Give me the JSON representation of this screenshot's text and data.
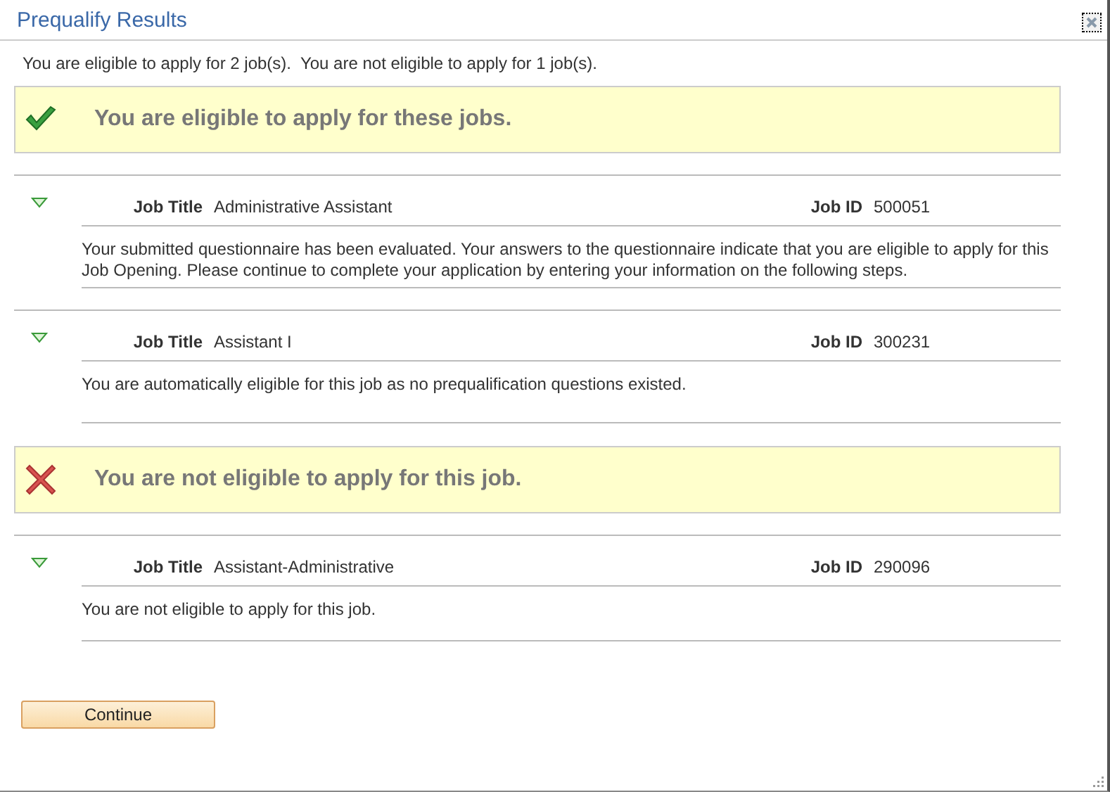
{
  "window": {
    "title": "Prequalify Results"
  },
  "summary": "You are eligible to apply for 2 job(s).  You are not eligible to apply for 1 job(s).",
  "sections": [
    {
      "kind": "eligible",
      "heading": "You are eligible to apply for these jobs.",
      "jobs": [
        {
          "expanded": true,
          "title_label": "Job Title",
          "title": "Administrative Assistant",
          "id_label": "Job ID",
          "id": "500051",
          "message": "Your submitted questionnaire has been evaluated. Your answers to the questionnaire indicate that you are eligible to apply for this Job Opening. Please continue to complete your application by entering your information on the following steps."
        },
        {
          "expanded": true,
          "title_label": "Job Title",
          "title": "Assistant I",
          "id_label": "Job ID",
          "id": "300231",
          "message": "You are automatically eligible for this job as no prequalification questions existed."
        }
      ]
    },
    {
      "kind": "not_eligible",
      "heading": "You are not eligible to apply for this job.",
      "jobs": [
        {
          "expanded": true,
          "title_label": "Job Title",
          "title": "Assistant-Administrative",
          "id_label": "Job ID",
          "id": "290096",
          "message": "You are not eligible to apply for this job."
        }
      ]
    }
  ],
  "buttons": [
    {
      "label": "Continue"
    }
  ]
}
